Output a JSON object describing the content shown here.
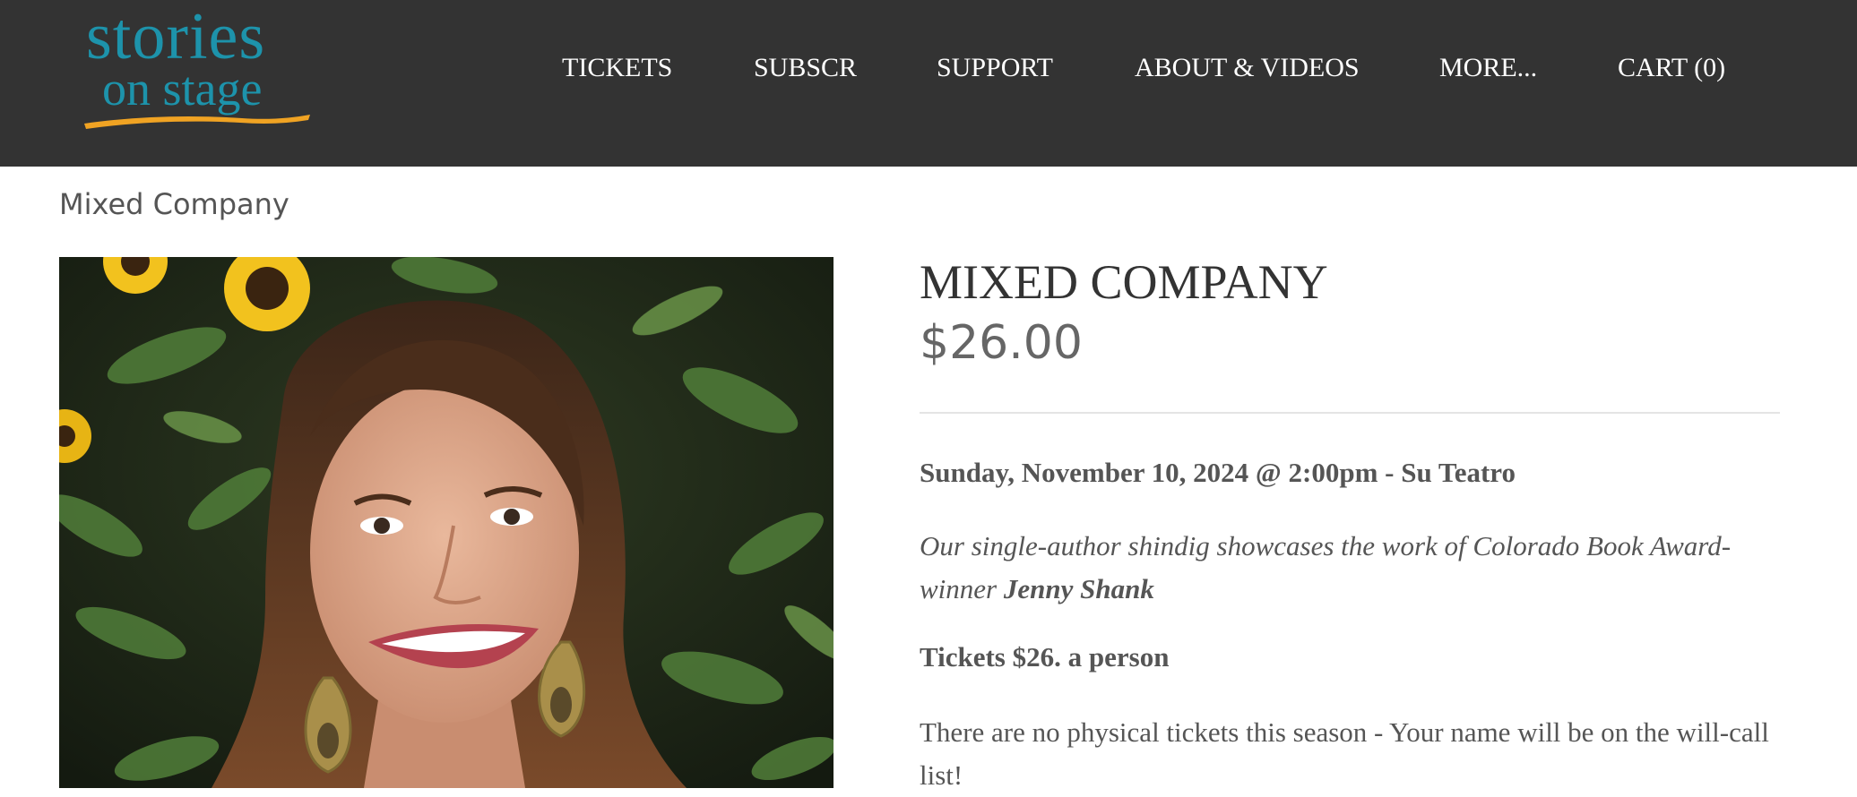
{
  "header": {
    "logo": {
      "line1": "stories",
      "line2": "on stage"
    },
    "nav": [
      {
        "label": "TICKETS"
      },
      {
        "label": "SUBSCR"
      },
      {
        "label": "SUPPORT"
      },
      {
        "label": "ABOUT & VIDEOS"
      },
      {
        "label": "MORE..."
      },
      {
        "label": "CART (0)"
      }
    ]
  },
  "breadcrumb": "Mixed Company",
  "product": {
    "title": "MIXED COMPANY",
    "price": "$26.00",
    "event_line": "Sunday, November 10, 2024 @ 2:00pm - Su Teatro",
    "description_prefix": "Our single-author shindig showcases the work of Colorado Book Award-winner ",
    "description_author": "Jenny Shank",
    "tickets_line": "Tickets $26. a person",
    "note": "There are no physical tickets this season - Your name will be on the will-call list!"
  },
  "colors": {
    "header_bg": "#333333",
    "logo_teal": "#1d93ab",
    "logo_swoosh_orange": "#f0a323",
    "text_gray": "#555555"
  }
}
